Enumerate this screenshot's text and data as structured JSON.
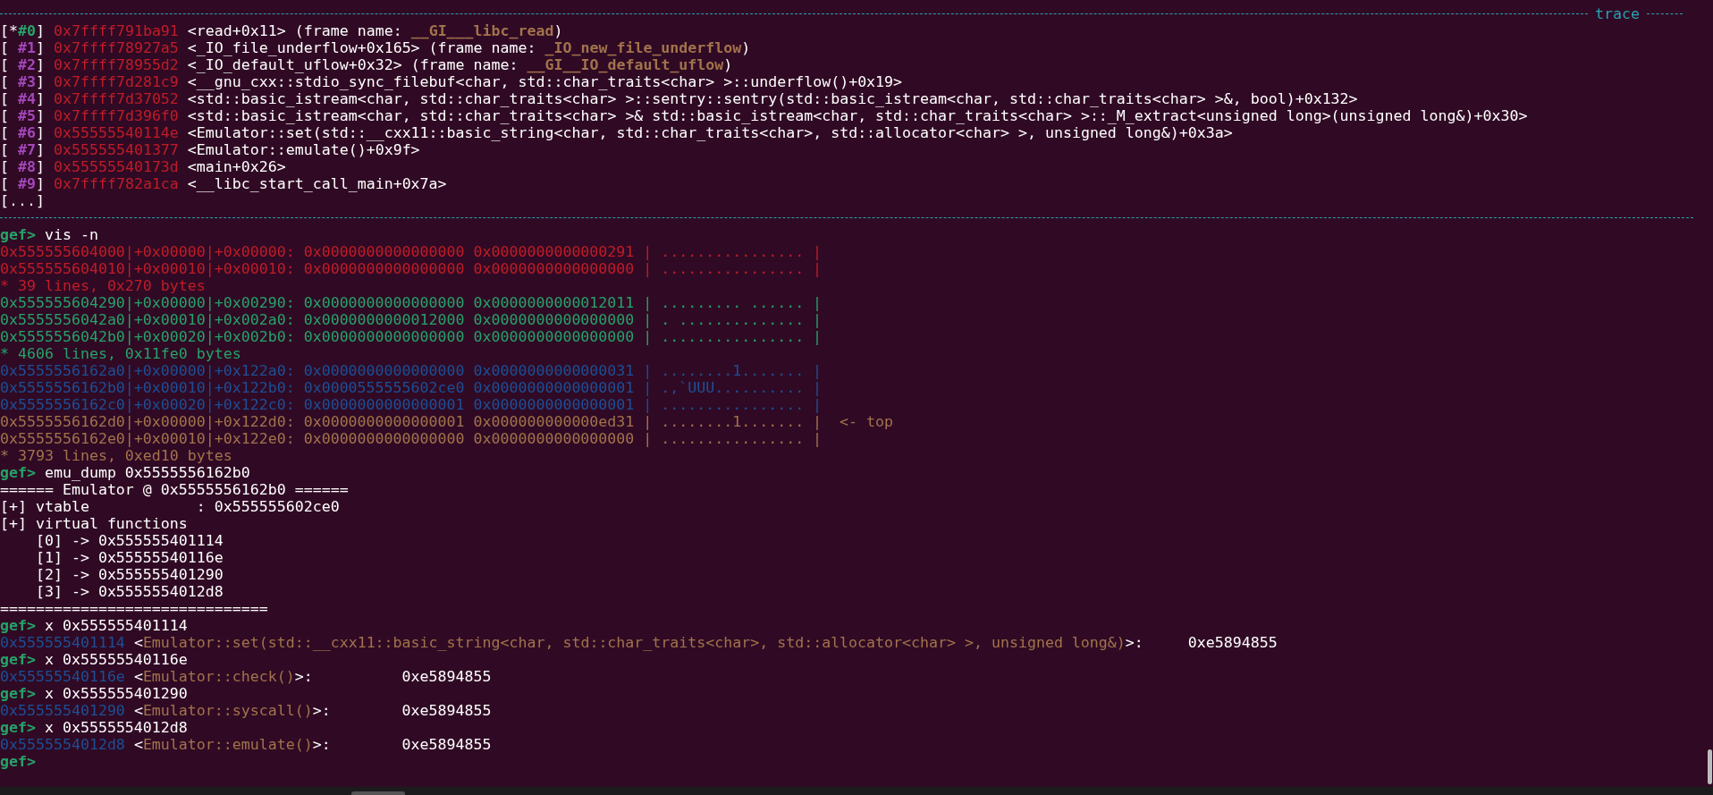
{
  "backtrace": {
    "label": "trace",
    "frames": [
      {
        "open": "[",
        "current_marker": "*",
        "index": "#0",
        "close": "]",
        "selected": true,
        "address": "0x7ffff791ba91",
        "symbol": "<read+0x11>",
        "frame_name_prefix": "(frame name:",
        "frame_name": "__GI___libc_read",
        "frame_name_suffix": ")"
      },
      {
        "open": "[",
        "index": "#1",
        "close": "]",
        "selected": false,
        "address": "0x7ffff78927a5",
        "symbol": "<_IO_file_underflow+0x165>",
        "frame_name_prefix": "(frame name:",
        "frame_name": "_IO_new_file_underflow",
        "frame_name_suffix": ")"
      },
      {
        "open": "[",
        "index": "#2",
        "close": "]",
        "selected": false,
        "address": "0x7ffff78955d2",
        "symbol": "<_IO_default_uflow+0x32>",
        "frame_name_prefix": "(frame name:",
        "frame_name": "__GI__IO_default_uflow",
        "frame_name_suffix": ")"
      },
      {
        "open": "[",
        "index": "#3",
        "close": "]",
        "selected": false,
        "address": "0x7ffff7d281c9",
        "symbol": "<__gnu_cxx::stdio_sync_filebuf<char, std::char_traits<char> >::underflow()+0x19>"
      },
      {
        "open": "[",
        "index": "#4",
        "close": "]",
        "selected": false,
        "address": "0x7ffff7d37052",
        "symbol": "<std::basic_istream<char, std::char_traits<char> >::sentry::sentry(std::basic_istream<char, std::char_traits<char> >&, bool)+0x132>"
      },
      {
        "open": "[",
        "index": "#5",
        "close": "]",
        "selected": false,
        "address": "0x7ffff7d396f0",
        "symbol": "<std::basic_istream<char, std::char_traits<char> >& std::basic_istream<char, std::char_traits<char> >::_M_extract<unsigned long>(unsigned long&)+0x30>"
      },
      {
        "open": "[",
        "index": "#6",
        "close": "]",
        "selected": false,
        "address": "0x55555540114e",
        "symbol": "<Emulator::set(std::__cxx11::basic_string<char, std::char_traits<char>, std::allocator<char> >, unsigned long&)+0x3a>"
      },
      {
        "open": "[",
        "index": "#7",
        "close": "]",
        "selected": false,
        "address": "0x555555401377",
        "symbol": "<Emulator::emulate()+0x9f>"
      },
      {
        "open": "[",
        "index": "#8",
        "close": "]",
        "selected": false,
        "address": "0x55555540173d",
        "symbol": "<main+0x26>"
      },
      {
        "open": "[",
        "index": "#9",
        "close": "]",
        "selected": false,
        "address": "0x7ffff782a1ca",
        "symbol": "<__libc_start_call_main+0x7a>"
      }
    ],
    "more": "[...]"
  },
  "session": [
    {
      "kind": "prompt",
      "prompt": "gef>",
      "command": "vis -n"
    },
    {
      "kind": "chunk",
      "color": "#c01c28",
      "rows": [
        {
          "text": "0x555555604000|+0x00000|+0x00000: 0x0000000000000000 0x0000000000000291 | ................ |"
        },
        {
          "text": "0x555555604010|+0x00010|+0x00010: 0x0000000000000000 0x0000000000000000 | ................ |"
        }
      ],
      "summary": "* 39 lines, 0x270 bytes"
    },
    {
      "kind": "chunk",
      "color": "#26a269",
      "rows": [
        {
          "text": "0x555555604290|+0x00000|+0x00290: 0x0000000000000000 0x0000000000012011 | ......... ...... |"
        },
        {
          "text": "0x5555556042a0|+0x00010|+0x002a0: 0x0000000000012000 0x0000000000000000 | . .............. |"
        },
        {
          "text": "0x5555556042b0|+0x00020|+0x002b0: 0x0000000000000000 0x0000000000000000 | ................ |"
        }
      ],
      "summary": "* 4606 lines, 0x11fe0 bytes"
    },
    {
      "kind": "chunk",
      "color": "#1c4f96",
      "rows": [
        {
          "text": "0x5555556162a0|+0x00000|+0x122a0: 0x0000000000000000 0x0000000000000031 | ........1....... |"
        },
        {
          "text": "0x5555556162b0|+0x00010|+0x122b0: 0x0000555555602ce0 0x0000000000000001 | .,`UUU.......... |"
        },
        {
          "text": "0x5555556162c0|+0x00020|+0x122c0: 0x0000000000000001 0x0000000000000001 | ................ |"
        }
      ]
    },
    {
      "kind": "chunk",
      "color": "#a2734c",
      "rows": [
        {
          "text": "0x5555556162d0|+0x00000|+0x122d0: 0x0000000000000001 0x000000000000ed31 | ........1....... |",
          "note": "<-  top"
        },
        {
          "text": "0x5555556162e0|+0x00010|+0x122e0: 0x0000000000000000 0x0000000000000000 | ................ |"
        }
      ],
      "summary": "* 3793 lines, 0xed10 bytes"
    },
    {
      "kind": "prompt",
      "prompt": "gef>",
      "command": "emu_dump 0x5555556162b0"
    },
    {
      "kind": "output",
      "text": "====== Emulator @ 0x5555556162b0 ======"
    },
    {
      "kind": "output",
      "text": "[+] vtable            : 0x555555602ce0"
    },
    {
      "kind": "output",
      "text": "[+] virtual functions"
    },
    {
      "kind": "entry",
      "text": "[0] -> 0x555555401114"
    },
    {
      "kind": "entry",
      "text": "[1] -> 0x55555540116e"
    },
    {
      "kind": "entry",
      "text": "[2] -> 0x555555401290"
    },
    {
      "kind": "entry",
      "text": "[3] -> 0x5555554012d8"
    },
    {
      "kind": "output",
      "text": "=============================="
    },
    {
      "kind": "prompt",
      "prompt": "gef>",
      "command": "x 0x555555401114"
    },
    {
      "kind": "symbol",
      "address": "0x555555401114",
      "open": "<",
      "symbol": "Emulator::set(std::__cxx11::basic_string<char, std::char_traits<char>, std::allocator<char> >, unsigned long&)",
      "close": ">:",
      "value": "0xe5894855"
    },
    {
      "kind": "prompt",
      "prompt": "gef>",
      "command": "x 0x55555540116e"
    },
    {
      "kind": "symbol",
      "address": "0x55555540116e",
      "open": "<",
      "symbol": "Emulator::check()",
      "close": ">:",
      "value": "0xe5894855"
    },
    {
      "kind": "prompt",
      "prompt": "gef>",
      "command": "x 0x555555401290"
    },
    {
      "kind": "symbol",
      "address": "0x555555401290",
      "open": "<",
      "symbol": "Emulator::syscall()",
      "close": ">:",
      "value": "0xe5894855"
    },
    {
      "kind": "prompt",
      "prompt": "gef>",
      "command": "x 0x5555554012d8"
    },
    {
      "kind": "symbol",
      "address": "0x5555554012d8",
      "open": "<",
      "symbol": "Emulator::emulate()",
      "close": ">:",
      "value": "0xe5894855"
    },
    {
      "kind": "prompt",
      "prompt": "gef>"
    }
  ]
}
